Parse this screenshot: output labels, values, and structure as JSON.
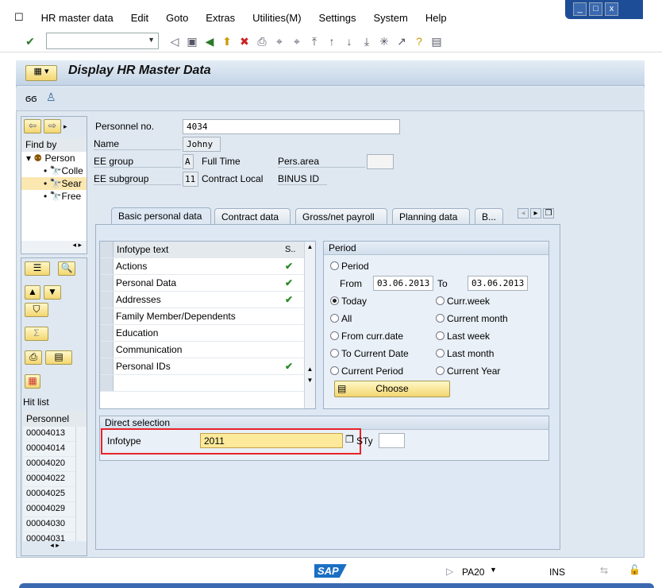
{
  "menu": [
    "HR master data",
    "Edit",
    "Goto",
    "Extras",
    "Utilities(M)",
    "Settings",
    "System",
    "Help"
  ],
  "window_controls": [
    "minimize",
    "maximize",
    "close"
  ],
  "toolbar": {
    "command_field": ""
  },
  "screen": {
    "title": "Display HR Master Data"
  },
  "nav": {
    "find_by": "Find by",
    "tree_root": "Person",
    "tree_items": [
      "Colle",
      "Sear",
      "Free"
    ],
    "hit_list": "Hit list",
    "hit_header": "Personnel",
    "hits": [
      "00004013",
      "00004014",
      "00004020",
      "00004022",
      "00004025",
      "00004029",
      "00004030",
      "00004031"
    ]
  },
  "header": {
    "pernr_label": "Personnel no.",
    "pernr": "4034",
    "name_label": "Name",
    "name": "Johny",
    "eeg_label": "EE group",
    "eeg": "A",
    "eeg_text": "Full Time",
    "parea_label": "Pers.area",
    "parea": "",
    "eesg_label": "EE subgroup",
    "eesg": "11",
    "eesg_text": "Contract Local",
    "parea_text": "BINUS ID"
  },
  "tabs": [
    "Basic personal data",
    "Contract data",
    "Gross/net payroll",
    "Planning data",
    "B..."
  ],
  "infotypes": {
    "col_text": "Infotype text",
    "col_status": "S..",
    "rows": [
      {
        "text": "Actions",
        "check": true
      },
      {
        "text": "Personal Data",
        "check": true
      },
      {
        "text": "Addresses",
        "check": true
      },
      {
        "text": "Family Member/Dependents",
        "check": false
      },
      {
        "text": "Education",
        "check": false
      },
      {
        "text": "Communication",
        "check": false
      },
      {
        "text": "Personal IDs",
        "check": true
      }
    ]
  },
  "period": {
    "title": "Period",
    "period": "Period",
    "from_label": "From",
    "from": "03.06.2013",
    "to_label": "To",
    "to": "03.06.2013",
    "options_left": [
      "Today",
      "All",
      "From curr.date",
      "To Current Date",
      "Current Period"
    ],
    "options_right": [
      "Curr.week",
      "Current month",
      "Last week",
      "Last month",
      "Current Year"
    ],
    "selected": "Today",
    "choose": "Choose"
  },
  "direct": {
    "title": "Direct selection",
    "infotype_label": "Infotype",
    "infotype": "2011",
    "sty_label": "STy",
    "sty": ""
  },
  "status": {
    "logo": "SAP",
    "tcode": "PA20",
    "mode": "INS"
  },
  "colors": {
    "highlight": "#e8232a",
    "input_active": "#fde99a",
    "accent": "#1d4d96"
  }
}
